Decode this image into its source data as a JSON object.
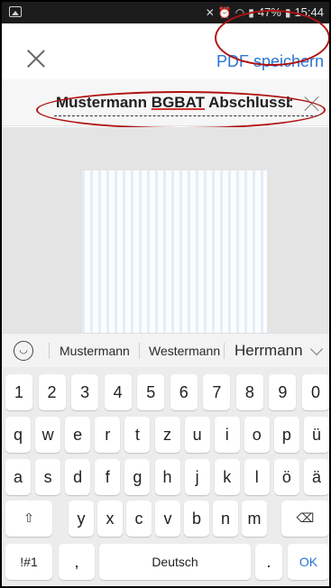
{
  "status_bar": {
    "icons": [
      "image-icon",
      "mute-icon",
      "alarm-icon",
      "wifi-icon",
      "signal-icon"
    ],
    "battery": "47%",
    "time": "15:44"
  },
  "toolbar": {
    "close_icon": "close-icon",
    "save_label": "PDF speichern"
  },
  "filename": {
    "part1": "Mustermann ",
    "part2": "BGBAT",
    "part3": " Abschlussb",
    "clear_icon": "clear-icon"
  },
  "suggestions": {
    "emoji_icon": "emoji-icon",
    "words": [
      "Mustermann",
      "Westermann",
      "Herrmann"
    ],
    "expand_icon": "chevron-down-icon"
  },
  "keyboard": {
    "row_numbers": [
      "1",
      "2",
      "3",
      "4",
      "5",
      "6",
      "7",
      "8",
      "9",
      "0"
    ],
    "row_1": [
      "q",
      "w",
      "e",
      "r",
      "t",
      "z",
      "u",
      "i",
      "o",
      "p",
      "ü"
    ],
    "row_2": [
      "a",
      "s",
      "d",
      "f",
      "g",
      "h",
      "j",
      "k",
      "l",
      "ö",
      "ä"
    ],
    "row_3": [
      "y",
      "x",
      "c",
      "v",
      "b",
      "n",
      "m"
    ],
    "symbols_label": "!#1",
    "comma_label": ",",
    "space_label": "Deutsch",
    "period_label": ".",
    "ok_label": "OK",
    "shift_icon": "shift-icon",
    "backspace_icon": "backspace-icon"
  },
  "colors": {
    "accent": "#2a74d4",
    "annotation": "#b01212"
  }
}
